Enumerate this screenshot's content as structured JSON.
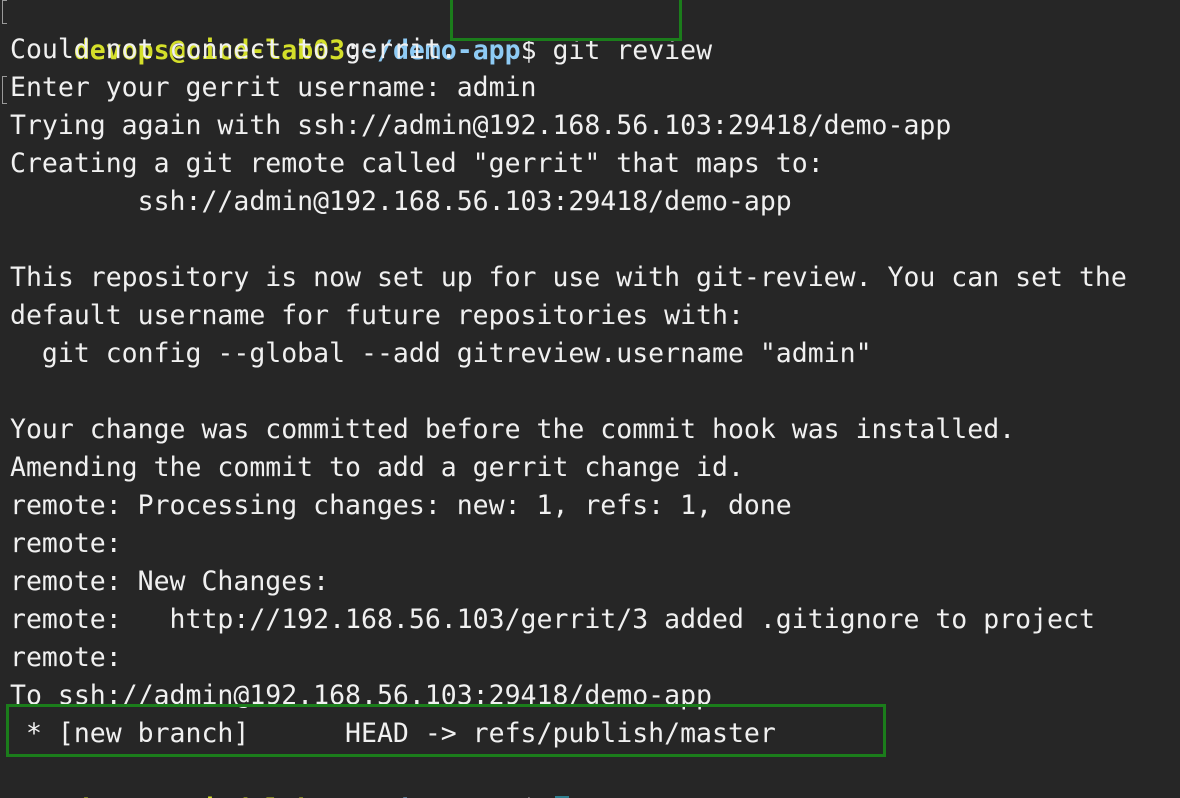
{
  "prompt": {
    "user_host": "devops@cicd-lab03",
    "separator": ":",
    "path": "~/demo-app",
    "symbol": "$"
  },
  "command": " git review",
  "output_lines": [
    "Could not connect to gerrit.",
    "Enter your gerrit username: admin",
    "Trying again with ssh://admin@192.168.56.103:29418/demo-app",
    "Creating a git remote called \"gerrit\" that maps to:",
    "        ssh://admin@192.168.56.103:29418/demo-app",
    "",
    "This repository is now set up for use with git-review. You can set the",
    "default username for future repositories with:",
    "  git config --global --add gitreview.username \"admin\"",
    "",
    "Your change was committed before the commit hook was installed.",
    "Amending the commit to add a gerrit change id.",
    "remote: Processing changes: new: 1, refs: 1, done",
    "remote:",
    "remote: New Changes:",
    "remote:   http://192.168.56.103/gerrit/3 added .gitignore to project",
    "remote:",
    "To ssh://admin@192.168.56.103:29418/demo-app",
    " * [new branch]      HEAD -> refs/publish/master"
  ],
  "colors": {
    "background": "#262626",
    "foreground": "#f0f0f0",
    "prompt_user": "#d4df2a",
    "prompt_path": "#8ecbf5",
    "annotation_box": "#1b7d1b",
    "cursor": "#2f7f8f"
  }
}
